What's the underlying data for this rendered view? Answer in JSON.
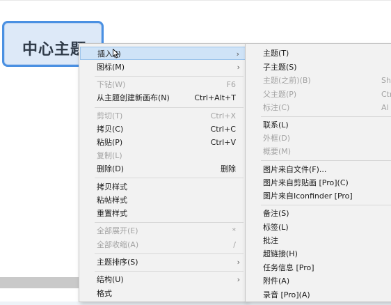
{
  "topic": {
    "label": "中心主题"
  },
  "main_menu": {
    "items": [
      {
        "label": "插入(I)",
        "shortcut": "",
        "submenu": true,
        "disabled": false,
        "highlighted": true
      },
      {
        "label": "图标(M)",
        "shortcut": "",
        "submenu": true,
        "disabled": false,
        "highlighted": false
      },
      {
        "label": "下钻(W)",
        "shortcut": "F6",
        "submenu": false,
        "disabled": true,
        "highlighted": false
      },
      {
        "label": "从主题创建新画布(N)",
        "shortcut": "Ctrl+Alt+T",
        "submenu": false,
        "disabled": false,
        "highlighted": false
      },
      {
        "label": "剪切(T)",
        "shortcut": "Ctrl+X",
        "submenu": false,
        "disabled": true,
        "highlighted": false
      },
      {
        "label": "拷贝(C)",
        "shortcut": "Ctrl+C",
        "submenu": false,
        "disabled": false,
        "highlighted": false
      },
      {
        "label": "粘贴(P)",
        "shortcut": "Ctrl+V",
        "submenu": false,
        "disabled": false,
        "highlighted": false
      },
      {
        "label": "复制(L)",
        "shortcut": "",
        "submenu": false,
        "disabled": true,
        "highlighted": false
      },
      {
        "label": "删除(D)",
        "shortcut": "删除",
        "submenu": false,
        "disabled": false,
        "highlighted": false
      },
      {
        "label": "拷贝样式",
        "shortcut": "",
        "submenu": false,
        "disabled": false,
        "highlighted": false
      },
      {
        "label": "粘帖样式",
        "shortcut": "",
        "submenu": false,
        "disabled": false,
        "highlighted": false
      },
      {
        "label": "重置样式",
        "shortcut": "",
        "submenu": false,
        "disabled": false,
        "highlighted": false
      },
      {
        "label": "全部展开(E)",
        "shortcut": "*",
        "submenu": false,
        "disabled": true,
        "highlighted": false
      },
      {
        "label": "全部收缩(A)",
        "shortcut": "/",
        "submenu": false,
        "disabled": true,
        "highlighted": false
      },
      {
        "label": "主题排序(S)",
        "shortcut": "",
        "submenu": true,
        "disabled": false,
        "highlighted": false
      },
      {
        "label": "结构(U)",
        "shortcut": "",
        "submenu": true,
        "disabled": false,
        "highlighted": false
      },
      {
        "label": "格式",
        "shortcut": "",
        "submenu": false,
        "disabled": false,
        "highlighted": false
      }
    ],
    "arrow_glyph": "›"
  },
  "insert_submenu": {
    "items": [
      {
        "label": "主题(T)",
        "shortcut": "",
        "disabled": false
      },
      {
        "label": "子主题(S)",
        "shortcut": "",
        "disabled": false
      },
      {
        "label": "主题(之前)(B)",
        "shortcut": "Shif",
        "disabled": true
      },
      {
        "label": "父主题(P)",
        "shortcut": "Ctr",
        "disabled": true
      },
      {
        "label": "标注(C)",
        "shortcut": "Al",
        "disabled": true
      },
      {
        "label": "联系(L)",
        "shortcut": "",
        "disabled": false
      },
      {
        "label": "外框(D)",
        "shortcut": "",
        "disabled": true
      },
      {
        "label": "概要(M)",
        "shortcut": "",
        "disabled": true
      },
      {
        "label": "图片来自文件(F)...",
        "shortcut": "",
        "disabled": false
      },
      {
        "label": "图片来自剪贴画 [Pro](C)",
        "shortcut": "",
        "disabled": false
      },
      {
        "label": "图片来自Iconfinder [Pro]",
        "shortcut": "",
        "disabled": false
      },
      {
        "label": "备注(S)",
        "shortcut": "",
        "disabled": false
      },
      {
        "label": "标签(L)",
        "shortcut": "",
        "disabled": false
      },
      {
        "label": "批注",
        "shortcut": "",
        "disabled": false
      },
      {
        "label": "超链接(H)",
        "shortcut": "",
        "disabled": false
      },
      {
        "label": "任务信息 [Pro]",
        "shortcut": "",
        "disabled": false
      },
      {
        "label": "附件(A)",
        "shortcut": "",
        "disabled": false
      },
      {
        "label": "录音 [Pro](A)",
        "shortcut": "",
        "disabled": false
      }
    ]
  }
}
